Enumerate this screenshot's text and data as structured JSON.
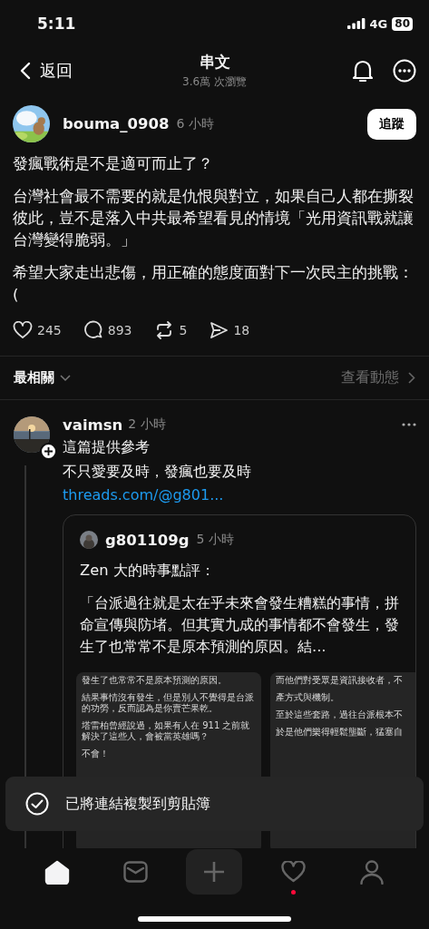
{
  "status_bar": {
    "time": "5:11",
    "network": "4G",
    "battery": "80"
  },
  "header": {
    "back": "返回",
    "title": "串文",
    "subtitle": "3.6萬 次瀏覽"
  },
  "post": {
    "author": "bouma_0908",
    "time": "6 小時",
    "follow": "追蹤",
    "paragraphs": [
      "發瘋戰術是不是適可而止了？",
      "台灣社會最不需要的就是仇恨與對立，如果自己人都在撕裂彼此，豈不是落入中共最希望看見的情境「光用資訊戰就讓台灣變得脆弱。」",
      "希望大家走出悲傷，用正確的態度面對下一次民主的挑戰：("
    ],
    "actions": [
      {
        "kind": "like",
        "count": "245"
      },
      {
        "kind": "comment",
        "count": "893"
      },
      {
        "kind": "repost",
        "count": "5"
      },
      {
        "kind": "share",
        "count": "18"
      }
    ]
  },
  "sort": {
    "label": "最相關",
    "view_activity": "查看動態"
  },
  "reply": {
    "author": "vaimsn",
    "time": "2 小時",
    "lines": [
      "這篇提供參考",
      "不只愛要及時，發瘋也要及時"
    ],
    "link": "threads.com/@g801...",
    "quote": {
      "author": "g801109g",
      "time": "5 小時",
      "paragraphs": [
        "Zen 大的時事點評：",
        "「台派過往就是太在乎未來會發生糟糕的事情，拼命宣傳與防堵。但其實九成的事情都不會發生，發生了也常常不是原本預測的原因。結..."
      ],
      "images": [
        {
          "paragraphs": [
            "發生了也常常不是原本預測的原因。",
            "結果事情沒有發生，但是別人不覺得是台派的功勞，反而認為是你賣芒果乾。",
            "塔雷柏曾經說過，如果有人在 911 之前就解決了這些人，會被當英雄嗎？",
            "不會！"
          ]
        },
        {
          "paragraphs": [
            "而他們對受眾是資訊接收者，不",
            "產方式與機制。",
            "至於這些套路，過往台派根本不",
            "於是他們樂得輕鬆壟斷，猛塞自"
          ]
        }
      ]
    }
  },
  "toast": {
    "text": "已將連結複製到剪貼簿"
  },
  "tab_bar": [
    {
      "kind": "home",
      "selected": true,
      "dot": false
    },
    {
      "kind": "messages",
      "selected": false,
      "dot": false
    },
    {
      "kind": "create",
      "selected": false,
      "dot": false
    },
    {
      "kind": "activity",
      "selected": false,
      "dot": true
    },
    {
      "kind": "profile",
      "selected": false,
      "dot": false
    }
  ]
}
